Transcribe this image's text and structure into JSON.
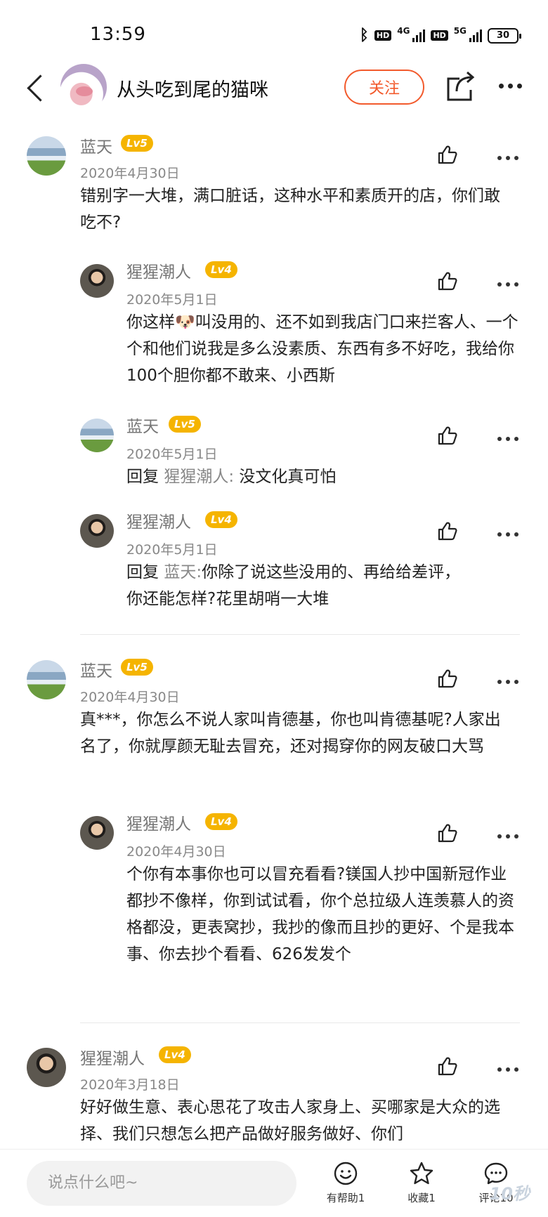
{
  "status_bar": {
    "time": "13:59",
    "hd1": "HD",
    "net1": "4G",
    "hd2": "HD",
    "net2": "5G",
    "battery": "30"
  },
  "header": {
    "title": "从头吃到尾的猫咪",
    "follow_label": "关注"
  },
  "comments": [
    {
      "user": "蓝天",
      "level": "Lv5",
      "date": "2020年4月30日",
      "text": "错别字一大堆，满口脏话，这种水平和素质开的店，你们敢吃不?",
      "replies": [
        {
          "user": "猩猩潮人",
          "level": "Lv4",
          "date": "2020年5月1日",
          "text": "你这样🐶叫没用的、还不如到我店门口来拦客人、一个个和他们说我是多么没素质、东西有多不好吃，我给你100个胆你都不敢来、小西斯"
        },
        {
          "user": "蓝天",
          "level": "Lv5",
          "date": "2020年5月1日",
          "prefix": "回复",
          "target": "猩猩潮人:",
          "text": "没文化真可怕"
        },
        {
          "user": "猩猩潮人",
          "level": "Lv4",
          "date": "2020年5月1日",
          "prefix": "回复",
          "target": "蓝天:",
          "text_line1": "你除了说这些没用的、再给给差评，",
          "text_line2": "你还能怎样?花里胡哨一大堆"
        }
      ]
    },
    {
      "user": "蓝天",
      "level": "Lv5",
      "date": "2020年4月30日",
      "text": "真***，你怎么不说人家叫肯德基，你也叫肯德基呢?人家出名了，你就厚颜无耻去冒充，还对揭穿你的网友破口大骂",
      "replies": [
        {
          "user": "猩猩潮人",
          "level": "Lv4",
          "date": "2020年4月30日",
          "text": "个你有本事你也可以冒充看看?镁国人抄中国新冠作业都抄不像样，你到试试看，你个总拉级人连羡慕人的资格都没，更表窝抄，我抄的像而且抄的更好、个是我本事、你去抄个看看、626发发个"
        }
      ]
    },
    {
      "user": "猩猩潮人",
      "level": "Lv4",
      "date": "2020年3月18日",
      "text": "好好做生意、表心思花了攻击人家身上、买哪家是大众的选择、我们只想怎么把产品做好服务做好、你们"
    }
  ],
  "bottom_bar": {
    "input_placeholder": "说点什么吧~",
    "helpful_label": "有帮助1",
    "favorite_label": "收藏1",
    "comment_label": "评论10",
    "watermark": "10秒"
  },
  "icons": {
    "back": "chevron-left-icon",
    "share": "share-icon",
    "more": "more-icon",
    "like": "thumbs-up-icon",
    "helpful": "smiley-icon",
    "favorite": "star-icon",
    "comment": "chat-bubble-icon"
  },
  "colors": {
    "accent": "#f25a2c",
    "level_badge": "#f5b400"
  }
}
